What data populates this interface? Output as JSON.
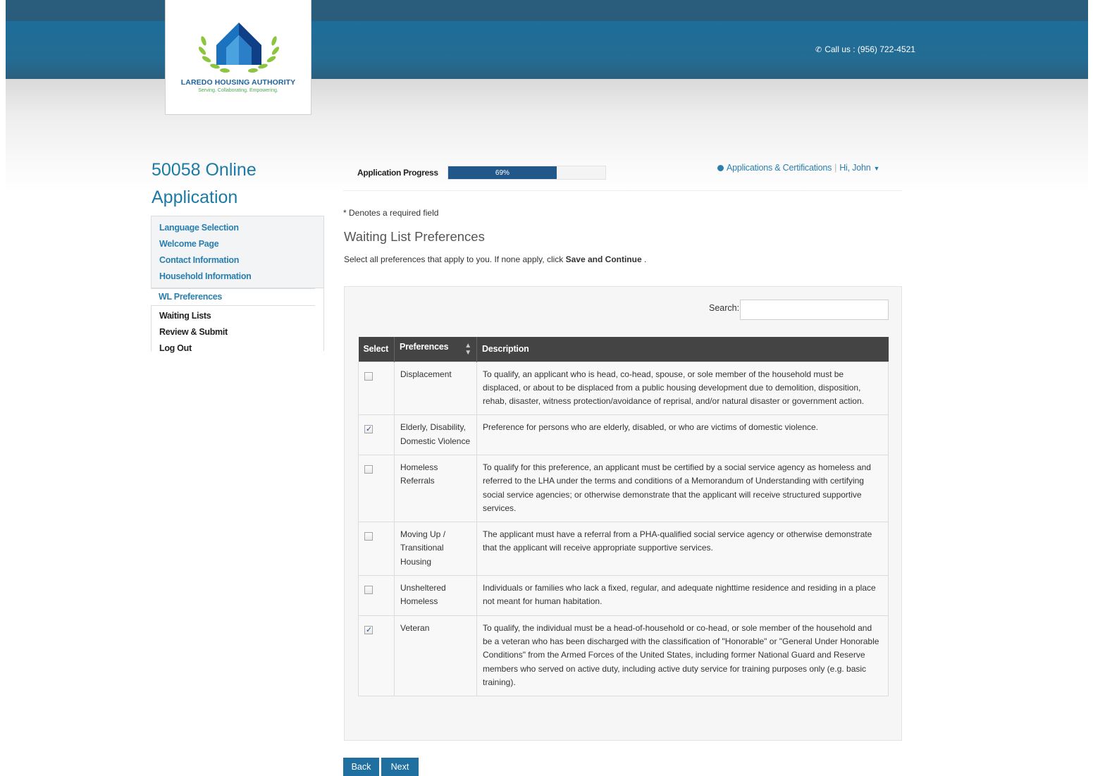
{
  "header": {
    "org_name": "LAREDO HOUSING AUTHORITY",
    "tagline": "Serving. Collaborating. Empowering.",
    "call_us": "Call us : (956) 722-4521"
  },
  "sidebar": {
    "title_line1": "50058 Online",
    "title_line2": "Application",
    "items": [
      {
        "label": "Language Selection"
      },
      {
        "label": "Welcome Page"
      },
      {
        "label": "Contact Information"
      },
      {
        "label": "Household Information"
      },
      {
        "label": "WL Preferences"
      },
      {
        "label": "Waiting Lists"
      },
      {
        "label": "Review & Submit"
      },
      {
        "label": "Log Out"
      }
    ]
  },
  "progress": {
    "label": "Application Progress",
    "value_text": "69%",
    "value": 0.69
  },
  "topnav": {
    "apps_link": "Applications & Certifications",
    "user_menu": "Hi, John"
  },
  "main": {
    "required_note": "* Denotes a required field",
    "section_title": "Waiting List Preferences",
    "instructions_prefix": "Select all preferences that apply to you. If none apply, click ",
    "instructions_bold": "Save and Continue",
    "instructions_suffix": " ."
  },
  "search": {
    "label": "Search:",
    "value": ""
  },
  "table": {
    "headers": [
      "Select",
      "Preferences",
      "Description"
    ],
    "rows": [
      {
        "checked": false,
        "preference": "Displacement",
        "description": "To qualify, an applicant who is head, co-head, spouse, or sole member of the household must be displaced, or about to be displaced from a public housing development due to demolition, disposition, rehab, disaster, witness protection/avoidance of reprisal, and/or natural disaster or government action."
      },
      {
        "checked": true,
        "preference": "Elderly, Disability, Domestic Violence",
        "description": "Preference for persons who are elderly, disabled, or who are victims of domestic violence."
      },
      {
        "checked": false,
        "preference": "Homeless Referrals",
        "description": "To qualify for this preference, an applicant must be certified by a social service agency as homeless and referred to the LHA under the terms and conditions of a Memorandum of Understanding with certifying social service agencies; or otherwise demonstrate that the applicant will receive structured supportive services."
      },
      {
        "checked": false,
        "preference": "Moving Up / Transitional Housing",
        "description": "The applicant must have a referral from a PHA-qualified social service agency or otherwise demonstrate that the applicant will receive appropriate supportive services."
      },
      {
        "checked": false,
        "preference": "Unsheltered Homeless",
        "description": "Individuals or families who lack a fixed, regular, and adequate nighttime residence and residing in a place not meant for human habitation."
      },
      {
        "checked": true,
        "preference": "Veteran",
        "description": "To qualify, the individual must be a head-of-household or co-head, or sole member of the household and be a veteran who has been discharged with the classification of \"Honorable\" or \"General Under Honorable Conditions\" from the Armed Forces of the United States, including former National Guard and Reserve members who served on active duty, including active duty service for training purposes only (e.g. basic training)."
      }
    ]
  },
  "buttons": {
    "back": "Back",
    "next": "Next"
  },
  "colors": {
    "brand_blue": "#1f6fa1",
    "link_blue": "#2a7fae",
    "header_bg": "#444444"
  }
}
